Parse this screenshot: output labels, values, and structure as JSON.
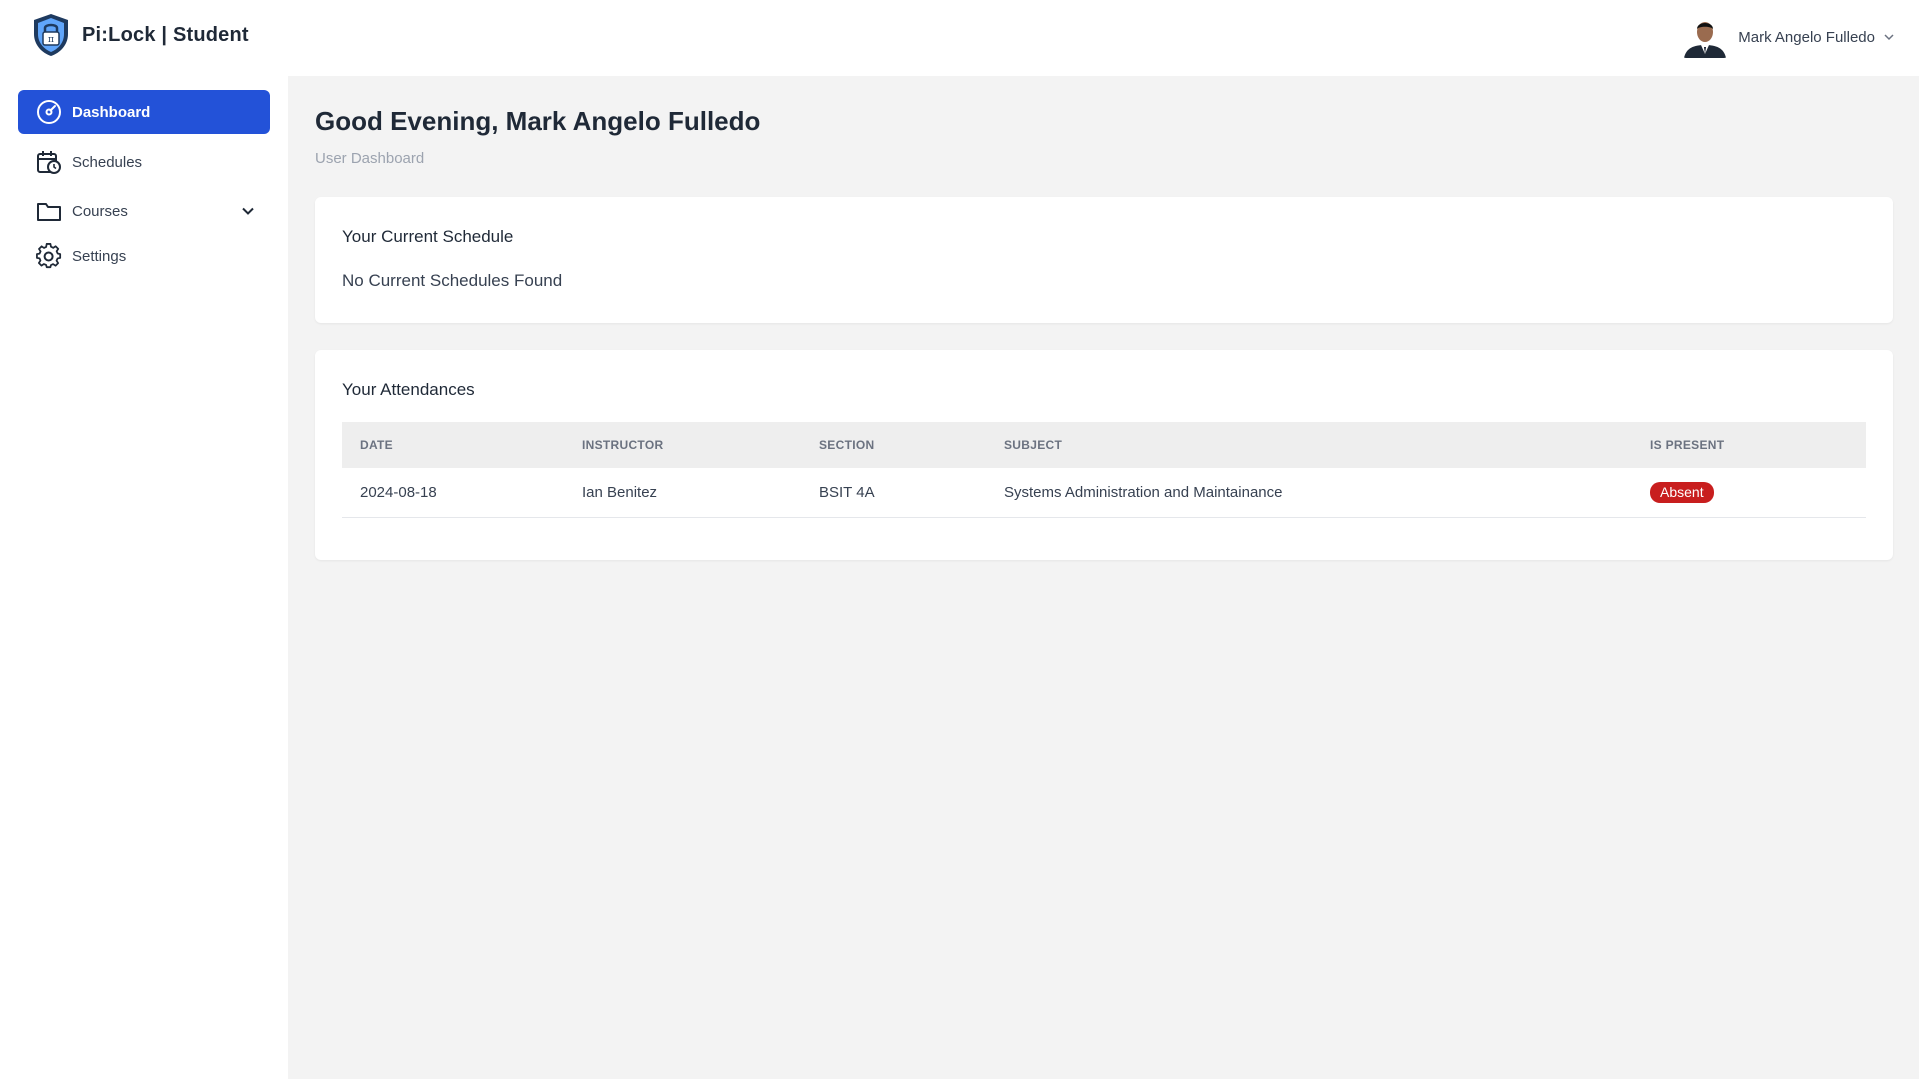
{
  "brand": {
    "name": "Pi:Lock | Student"
  },
  "user": {
    "name": "Mark Angelo Fulledo"
  },
  "sidebar": {
    "items": [
      {
        "label": "Dashboard",
        "icon": "dashboard-gauge-icon",
        "active": true
      },
      {
        "label": "Schedules",
        "icon": "calendar-clock-icon"
      },
      {
        "label": "Courses",
        "icon": "folder-icon",
        "expandable": true
      },
      {
        "label": "Settings",
        "icon": "gear-icon"
      }
    ]
  },
  "main": {
    "title": "Good Evening, Mark Angelo Fulledo",
    "subtitle": "User Dashboard",
    "schedule_card": {
      "title": "Your Current Schedule",
      "empty_text": "No Current Schedules Found"
    },
    "attendance_card": {
      "title": "Your Attendances",
      "columns": [
        "DATE",
        "INSTRUCTOR",
        "SECTION",
        "SUBJECT",
        "IS PRESENT"
      ],
      "rows": [
        {
          "date": "2024-08-18",
          "instructor": "Ian Benitez",
          "section": "BSIT 4A",
          "subject": "Systems Administration and Maintainance",
          "status": "Absent"
        }
      ]
    }
  },
  "colors": {
    "accent": "#2352d8",
    "absent_badge": "#c81e1e",
    "main_background": "#f3f3f3"
  }
}
